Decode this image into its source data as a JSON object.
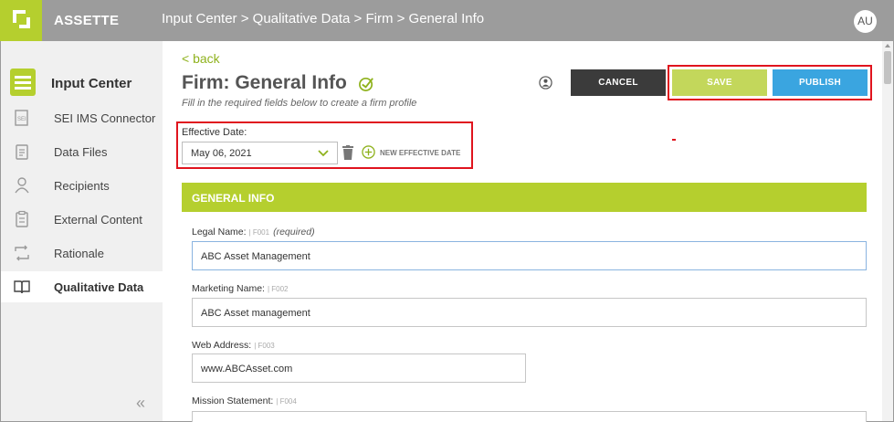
{
  "app": {
    "brand": "ASSETTE",
    "breadcrumb": "Input Center > Qualitative Data > Firm > General Info",
    "avatar_initials": "AU"
  },
  "sidebar": {
    "header": {
      "label": "Input Center",
      "icon": "input-center-icon"
    },
    "items": [
      {
        "label": "SEI IMS Connector",
        "icon": "connector-icon",
        "active": false
      },
      {
        "label": "Data Files",
        "icon": "data-files-icon",
        "active": false
      },
      {
        "label": "Recipients",
        "icon": "recipients-icon",
        "active": false
      },
      {
        "label": "External Content",
        "icon": "external-content-icon",
        "active": false
      },
      {
        "label": "Rationale",
        "icon": "rationale-icon",
        "active": false
      },
      {
        "label": "Qualitative Data",
        "icon": "book-icon",
        "active": true
      }
    ],
    "collapse_label": "«"
  },
  "main": {
    "back_label": "< back",
    "title": "Firm: General Info",
    "subtitle": "Fill in the required fields below to create a firm profile",
    "buttons": {
      "cancel": "CANCEL",
      "save": "SAVE",
      "publish": "PUBLISH"
    },
    "effective_date": {
      "label": "Effective Date:",
      "value": "May 06, 2021",
      "new_label": "NEW EFFECTIVE DATE"
    },
    "section_title": "GENERAL INFO",
    "fields": [
      {
        "label": "Legal Name:",
        "code": "| F001",
        "note": "(required)",
        "value": "ABC Asset Management"
      },
      {
        "label": "Marketing Name:",
        "code": "| F002",
        "note": "",
        "value": "ABC Asset management"
      },
      {
        "label": "Web Address:",
        "code": "| F003",
        "note": "",
        "value": "www.ABCAsset.com"
      },
      {
        "label": "Mission Statement:",
        "code": "| F004",
        "note": "",
        "value": ""
      }
    ]
  },
  "colors": {
    "brand_green": "#b5cf2e",
    "topbar_gray": "#9c9c9c",
    "publish_blue": "#3aa5e0",
    "cancel_dark": "#3b3b3b",
    "highlight_red": "#e0141e"
  }
}
